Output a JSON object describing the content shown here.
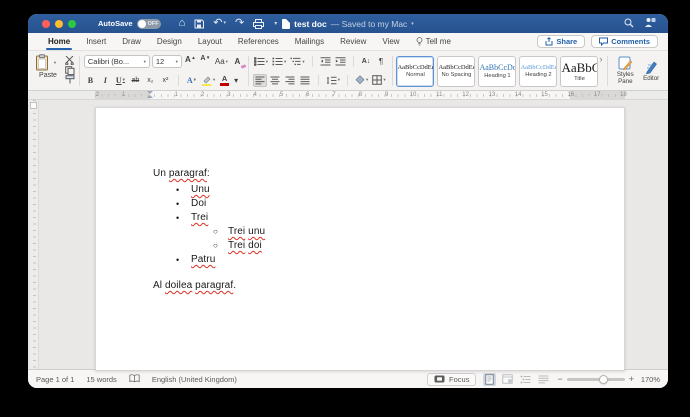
{
  "titlebar": {
    "autosave_label": "AutoSave",
    "autosave_state": "OFF",
    "doc_title": "test doc",
    "save_status": "— Saved to my Mac"
  },
  "tabs": [
    {
      "label": "Home",
      "active": true
    },
    {
      "label": "Insert",
      "active": false
    },
    {
      "label": "Draw",
      "active": false
    },
    {
      "label": "Design",
      "active": false
    },
    {
      "label": "Layout",
      "active": false
    },
    {
      "label": "References",
      "active": false
    },
    {
      "label": "Mailings",
      "active": false
    },
    {
      "label": "Review",
      "active": false
    },
    {
      "label": "View",
      "active": false
    },
    {
      "label": "Tell me",
      "active": false,
      "bulb": true
    }
  ],
  "actions": {
    "share": "Share",
    "comments": "Comments"
  },
  "ribbon": {
    "paste_label": "Paste",
    "font_name": "Calibri (Bo...",
    "font_size": "12",
    "styles_pane_label": "Styles Pane",
    "editor_label": "Editor",
    "styles": [
      {
        "sample": "AaBbCcDdEe",
        "name": "Normal",
        "selected": true,
        "color": "#1a1a1a",
        "sample_size": 6.5
      },
      {
        "sample": "AaBbCcDdEe",
        "name": "No Spacing",
        "selected": false,
        "color": "#1a1a1a",
        "sample_size": 6.5
      },
      {
        "sample": "AaBbCcDc",
        "name": "Heading 1",
        "selected": false,
        "color": "#2e74b5",
        "sample_size": 8
      },
      {
        "sample": "AaBbCcDdEe",
        "name": "Heading 2",
        "selected": false,
        "color": "#5b9bd5",
        "sample_size": 6.5
      },
      {
        "sample": "AaBbC",
        "name": "Title",
        "selected": false,
        "color": "#1a1a1a",
        "sample_size": 13
      }
    ]
  },
  "icons": {
    "caret": "▾",
    "more": "›",
    "home": "⌂",
    "undo": "↶",
    "redo": "↷",
    "bold": "B",
    "italic": "I",
    "underline": "U",
    "strikethrough": "ab",
    "subscript": "x₂",
    "superscript": "x²",
    "change_case": "Aa",
    "grow_font": "A",
    "shrink_font": "A",
    "grow_arrow": "▲",
    "shrink_arrow": "▼",
    "text_effects": "A",
    "font_color": "A",
    "clear_formatting": "A",
    "sort": "A↓",
    "pilcrow": "¶",
    "bullet_l1": "•",
    "bullet_l2": "○",
    "minus": "−",
    "plus": "+"
  },
  "colors": {
    "titlebar_blue": "#2a5795",
    "accent_blue": "#2563ac",
    "heading_blue": "#2e74b5",
    "squiggle_red": "#d93025",
    "highlight_yellow": "#f7e64a",
    "font_color_red": "#c00000"
  },
  "ruler": {
    "left_numbers": [
      "2",
      "1"
    ],
    "numbers": [
      "1",
      "2",
      "3",
      "4",
      "5",
      "6",
      "7",
      "8",
      "9",
      "10",
      "11",
      "12",
      "13",
      "14",
      "15",
      "16",
      "17",
      "18"
    ]
  },
  "document": {
    "lines": [
      {
        "type": "p",
        "segments": [
          {
            "text": "Un ",
            "misspelled": false
          },
          {
            "text": "paragraf",
            "misspelled": true
          },
          {
            "text": ":",
            "misspelled": false
          }
        ]
      },
      {
        "type": "b1",
        "segments": [
          {
            "text": "Unu",
            "misspelled": true
          }
        ]
      },
      {
        "type": "b1",
        "segments": [
          {
            "text": "Doi",
            "misspelled": false
          }
        ]
      },
      {
        "type": "b1",
        "segments": [
          {
            "text": "Trei",
            "misspelled": true
          }
        ]
      },
      {
        "type": "b2",
        "segments": [
          {
            "text": "Trei",
            "misspelled": true
          },
          {
            "text": " ",
            "misspelled": false
          },
          {
            "text": "unu",
            "misspelled": true
          }
        ]
      },
      {
        "type": "b2",
        "segments": [
          {
            "text": "Trei",
            "misspelled": true
          },
          {
            "text": " ",
            "misspelled": false
          },
          {
            "text": "doi",
            "misspelled": true
          }
        ]
      },
      {
        "type": "b1",
        "segments": [
          {
            "text": "Patru",
            "misspelled": true
          }
        ]
      },
      {
        "type": "blank",
        "segments": []
      },
      {
        "type": "p",
        "segments": [
          {
            "text": "Al ",
            "misspelled": false
          },
          {
            "text": "doilea",
            "misspelled": true
          },
          {
            "text": " ",
            "misspelled": false
          },
          {
            "text": "paragraf",
            "misspelled": true
          },
          {
            "text": ".",
            "misspelled": false
          }
        ]
      }
    ]
  },
  "statusbar": {
    "page_count": "Page 1 of 1",
    "word_count": "15 words",
    "language": "English (United Kingdom)",
    "focus_label": "Focus",
    "zoom_level": "170%"
  }
}
